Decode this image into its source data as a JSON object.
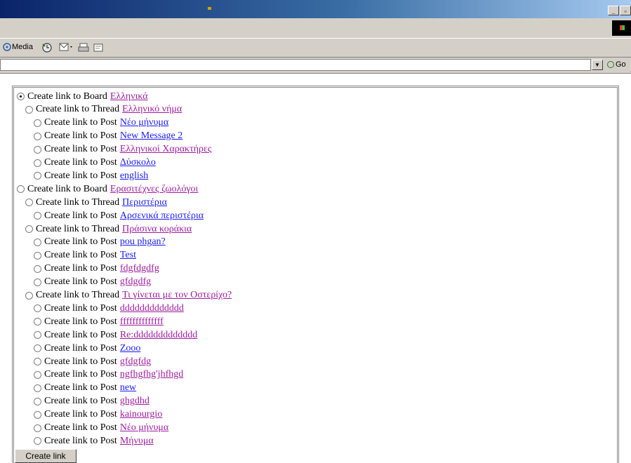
{
  "toolbar": {
    "media_label": "Media"
  },
  "address": {
    "go_label": "Go"
  },
  "form": {
    "submit_label": "Create link",
    "items": [
      {
        "kind": "Board",
        "label": "Create link to Board",
        "link": "Ελληνικά",
        "link_color": "#a01ca0",
        "checked": true
      },
      {
        "kind": "Thread",
        "label": "Create link to Thread",
        "link": "Ελληνικό νήμα",
        "link_color": "#a01ca0",
        "checked": false
      },
      {
        "kind": "Post",
        "label": "Create link to Post",
        "link": "Νέο μήνυμα",
        "link_color": "#1a1aff",
        "checked": false
      },
      {
        "kind": "Post",
        "label": "Create link to Post",
        "link": "New Message 2",
        "link_color": "#1a1aff",
        "checked": false
      },
      {
        "kind": "Post",
        "label": "Create link to Post",
        "link": "Ελληνικοί Χαρακτήρες",
        "link_color": "#a01ca0",
        "checked": false
      },
      {
        "kind": "Post",
        "label": "Create link to Post",
        "link": "Δύσκολο",
        "link_color": "#1a1aff",
        "checked": false
      },
      {
        "kind": "Post",
        "label": "Create link to Post",
        "link": "english",
        "link_color": "#1a1aff",
        "checked": false
      },
      {
        "kind": "Board",
        "label": "Create link to Board",
        "link": "Ερασιτέχνες ζωολόγοι",
        "link_color": "#a01ca0",
        "checked": false
      },
      {
        "kind": "Thread",
        "label": "Create link to Thread",
        "link": "Περιστέρια",
        "link_color": "#1a1aff",
        "checked": false
      },
      {
        "kind": "Post",
        "label": "Create link to Post",
        "link": "Αρσενικά περιστέρια",
        "link_color": "#1a1aff",
        "checked": false
      },
      {
        "kind": "Thread",
        "label": "Create link to Thread",
        "link": "Πράσινα κοράκια",
        "link_color": "#a01ca0",
        "checked": false
      },
      {
        "kind": "Post",
        "label": "Create link to Post",
        "link": "pou phgan?",
        "link_color": "#1a1aff",
        "checked": false
      },
      {
        "kind": "Post",
        "label": "Create link to Post",
        "link": "Test",
        "link_color": "#1a1aff",
        "checked": false
      },
      {
        "kind": "Post",
        "label": "Create link to Post",
        "link": "fdgfdgdfg",
        "link_color": "#a01ca0",
        "checked": false
      },
      {
        "kind": "Post",
        "label": "Create link to Post",
        "link": "gfdgdfg",
        "link_color": "#a01ca0",
        "checked": false
      },
      {
        "kind": "Thread",
        "label": "Create link to Thread",
        "link": "Τι γίνεται με τον Οστερίχο?",
        "link_color": "#a01ca0",
        "checked": false
      },
      {
        "kind": "Post",
        "label": "Create link to Post",
        "link": "ddddddddddddd",
        "link_color": "#a01ca0",
        "checked": false
      },
      {
        "kind": "Post",
        "label": "Create link to Post",
        "link": "ffffffffffffff",
        "link_color": "#a01ca0",
        "checked": false
      },
      {
        "kind": "Post",
        "label": "Create link to Post",
        "link": "Re:ddddddddddddd",
        "link_color": "#a01ca0",
        "checked": false
      },
      {
        "kind": "Post",
        "label": "Create link to Post",
        "link": "Zooo",
        "link_color": "#1a1aff",
        "checked": false
      },
      {
        "kind": "Post",
        "label": "Create link to Post",
        "link": "gfdgfdg",
        "link_color": "#a01ca0",
        "checked": false
      },
      {
        "kind": "Post",
        "label": "Create link to Post",
        "link": "ngfhgfhg'jhfhgd",
        "link_color": "#a01ca0",
        "checked": false
      },
      {
        "kind": "Post",
        "label": "Create link to Post",
        "link": "new",
        "link_color": "#1a1aff",
        "checked": false
      },
      {
        "kind": "Post",
        "label": "Create link to Post",
        "link": "ghgdhd",
        "link_color": "#a01ca0",
        "checked": false
      },
      {
        "kind": "Post",
        "label": "Create link to Post",
        "link": "kainourgio",
        "link_color": "#a01ca0",
        "checked": false
      },
      {
        "kind": "Post",
        "label": "Create link to Post",
        "link": "Νέο μήνυμα",
        "link_color": "#a01ca0",
        "checked": false
      },
      {
        "kind": "Post",
        "label": "Create link to Post",
        "link": "Μήνυμα",
        "link_color": "#a01ca0",
        "checked": false
      }
    ]
  }
}
